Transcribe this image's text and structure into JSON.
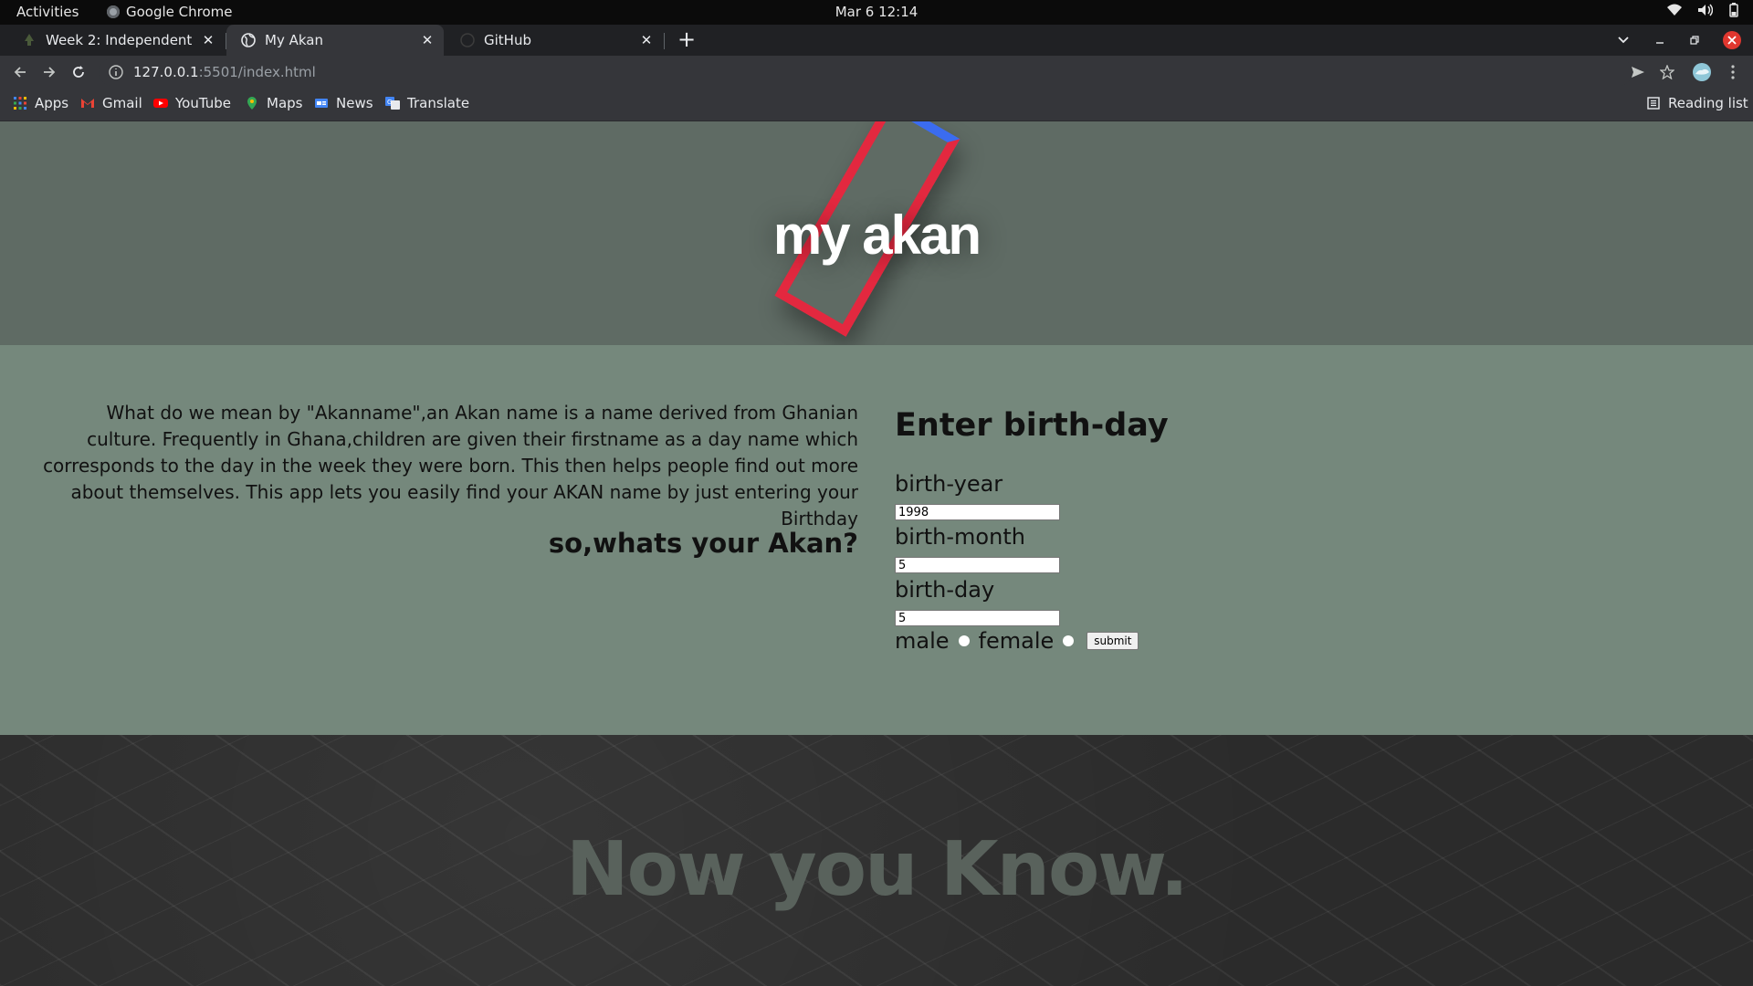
{
  "system_bar": {
    "activities": "Activities",
    "app_name": "Google Chrome",
    "clock": "Mar 6  12:14"
  },
  "tabs": [
    {
      "title": "Week 2: Independent Proj",
      "active": false
    },
    {
      "title": "My Akan",
      "active": true
    },
    {
      "title": "GitHub",
      "active": false
    }
  ],
  "toolbar": {
    "url_host": "127.0.0.1",
    "url_rest": ":5501/index.html"
  },
  "bookmarks": [
    {
      "label": "Apps",
      "icon": "apps-grid-icon"
    },
    {
      "label": "Gmail",
      "icon": "gmail-icon"
    },
    {
      "label": "YouTube",
      "icon": "youtube-icon"
    },
    {
      "label": "Maps",
      "icon": "maps-icon"
    },
    {
      "label": "News",
      "icon": "news-icon"
    },
    {
      "label": "Translate",
      "icon": "translate-icon"
    }
  ],
  "reading_list": "Reading list",
  "page": {
    "hero_title": "my akan",
    "intro": "What do we mean by \"Akanname\",an Akan name is a name derived from Ghanian culture. Frequently in Ghana,children are given their firstname as a day name which corresponds to the day in the week they were born. This then helps people find out more about themselves. This app lets you easily find your AKAN name by just entering your Birthday",
    "question": "so,whats your Akan?",
    "form": {
      "heading": "Enter birth-day",
      "year_label": "birth-year",
      "year_value": "1998",
      "month_label": "birth-month",
      "month_value": "5",
      "day_label": "birth-day",
      "day_value": "5",
      "male_label": "male",
      "female_label": "female",
      "submit_label": "submit"
    },
    "footer_text": "Now you Know."
  },
  "colors": {
    "hero_bg": "#5f6b64",
    "content_bg": "#75887c",
    "accent_red": "#e3283f",
    "accent_blue": "#3b6cf0"
  }
}
